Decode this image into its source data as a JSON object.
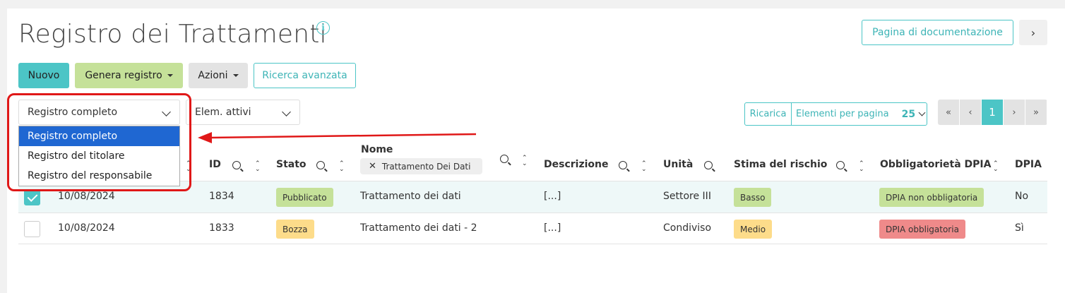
{
  "page": {
    "title": "Registro dei Trattamenti",
    "doc_button": "Pagina di documentazione",
    "next_label": "›"
  },
  "toolbar": {
    "new_label": "Nuovo",
    "generate_label": "Genera registro",
    "actions_label": "Azioni",
    "advanced_search_label": "Ricerca avanzata"
  },
  "filters": {
    "register_select": "Registro completo",
    "register_options": [
      "Registro completo",
      "Registro del titolare",
      "Registro del responsabile"
    ],
    "status_select": "Elem. attivi"
  },
  "pagination": {
    "reload_label": "Ricarica",
    "per_page_label": "Elementi per pagina",
    "per_page_value": "25",
    "first": "«",
    "prev": "‹",
    "current": "1",
    "next": "›",
    "last": "»"
  },
  "table": {
    "headers": {
      "id": "ID",
      "stato": "Stato",
      "nome": "Nome",
      "descrizione": "Descrizione",
      "unita": "Unità",
      "stima": "Stima del rischio",
      "obbligatorieta": "Obbligatorietà DPIA",
      "dpia": "DPIA"
    },
    "nome_filter_chip": "Trattamento Dei Dati",
    "rows": [
      {
        "checked": true,
        "date": "10/08/2024",
        "id": "1834",
        "stato": "Pubblicato",
        "nome": "Trattamento dei dati",
        "descrizione": "[...]",
        "unita": "Settore III",
        "stima": "Basso",
        "obbligatorieta": "DPIA non obbligatoria",
        "dpia": "No"
      },
      {
        "checked": false,
        "date": "10/08/2024",
        "id": "1833",
        "stato": "Bozza",
        "nome": "Trattamento dei dati - 2",
        "descrizione": "[...]",
        "unita": "Condiviso",
        "stima": "Medio",
        "obbligatorieta": "DPIA obbligatoria",
        "dpia": "Sì"
      }
    ]
  },
  "colors": {
    "accent": "#4cc5c6",
    "success": "#c5e199",
    "warning": "#fddc8a",
    "danger": "#ef8a8a",
    "selection": "#1f67d2",
    "annotation": "#e01818"
  }
}
